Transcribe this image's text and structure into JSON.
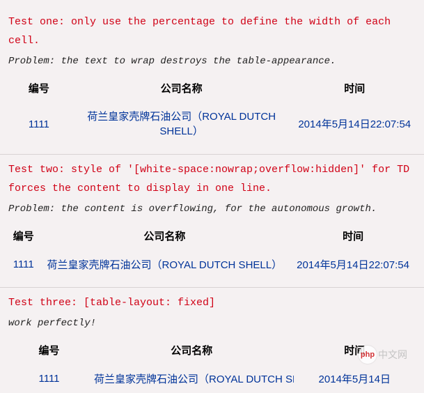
{
  "test1": {
    "title": "Test one: only use the percentage to define the width of each cell.",
    "problem": "Problem: the text to wrap destroys the table-appearance.",
    "headers": {
      "c1": "编号",
      "c2": "公司名称",
      "c3": "时间"
    },
    "row": {
      "c1": "1111",
      "c2": "荷兰皇家壳牌石油公司（ROYAL DUTCH SHELL）",
      "c3": "2014年5月14日22:07:54"
    }
  },
  "test2": {
    "title": "Test two: style of '[white-space:nowrap;overflow:hidden]' for TD forces the content to display in one line.",
    "problem": "Problem: the content is overflowing, for the autonomous growth.",
    "headers": {
      "c1": "编号",
      "c2": "公司名称",
      "c3": "时间"
    },
    "row": {
      "c1": "1111",
      "c2": "荷兰皇家壳牌石油公司（ROYAL DUTCH SHELL）",
      "c3": "2014年5月14日22:07:54"
    }
  },
  "test3": {
    "title": "Test three: [table-layout: fixed]",
    "problem": "work perfectly!",
    "headers": {
      "c1": "编号",
      "c2": "公司名称",
      "c3": "时间"
    },
    "row": {
      "c1": "1111",
      "c2": "荷兰皇家壳牌石油公司（ROYAL DUTCH SHELL）",
      "c3": "2014年5月14日"
    }
  },
  "watermark": {
    "logo": "php",
    "text": "中文网"
  }
}
